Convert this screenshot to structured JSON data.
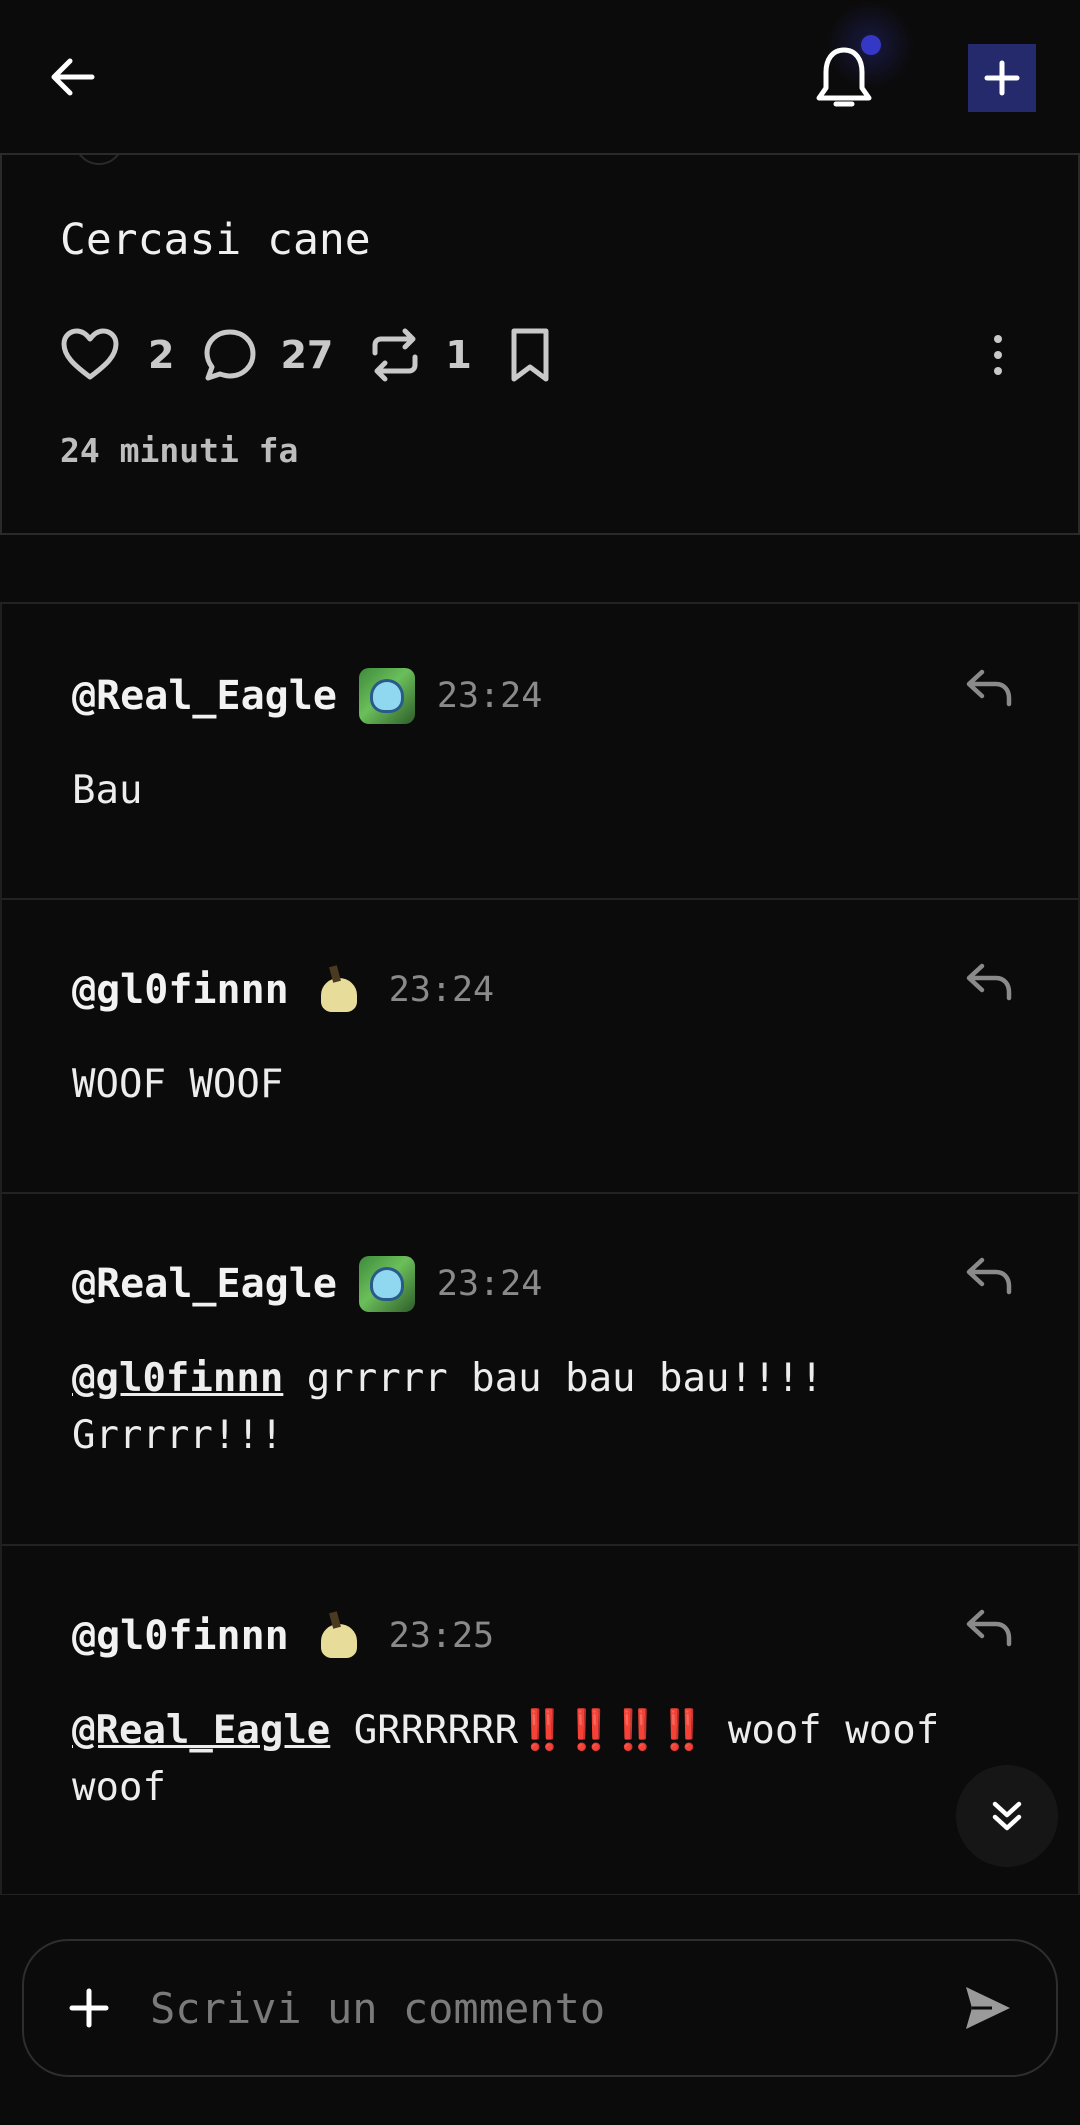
{
  "header": {
    "back_icon": "arrow-left-icon",
    "notifications_icon": "bell-icon",
    "notification_dot_color": "#3438c4",
    "new_post_icon": "plus-icon",
    "new_post_color": "#242a6b"
  },
  "post": {
    "text": "Cercasi cane",
    "likes": "2",
    "comments": "27",
    "reposts": "1",
    "time_ago": "24 minuti fa"
  },
  "comments": [
    {
      "user": "@Real_Eagle",
      "badge": "pokemon-badge-icon",
      "time": "23:24",
      "text": "Bau"
    },
    {
      "user": "@gl0finnn",
      "badge": "mimikyu-badge-icon",
      "time": "23:24",
      "text": "WOOF WOOF"
    },
    {
      "user": "@Real_Eagle",
      "badge": "pokemon-badge-icon",
      "time": "23:24",
      "mention": "@gl0finnn",
      "text": " grrrrr bau bau bau!!!! Grrrrr!!!"
    },
    {
      "user": "@gl0finnn",
      "badge": "mimikyu-badge-icon",
      "time": "23:25",
      "mention": "@Real_Eagle",
      "text_a": " GRRRRRR",
      "emphasis": "‼️‼️‼️‼️",
      "text_b": " woof woof woof"
    }
  ],
  "composer": {
    "placeholder": "Scrivi un commento",
    "add_icon": "plus-icon",
    "send_icon": "send-icon"
  }
}
